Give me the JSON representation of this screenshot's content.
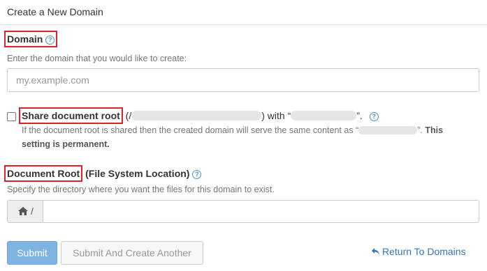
{
  "header": {
    "title": "Create a New Domain"
  },
  "domain": {
    "label": "Domain",
    "hint": "Enter the domain that you would like to create:",
    "placeholder": "my.example.com",
    "value": ""
  },
  "share_root": {
    "label": "Share document root",
    "open_paren": " (/",
    "with_text": ") with “",
    "close_text": "”.",
    "hint": "If the document root is shared then the created domain will serve the same content as “",
    "hint_end": "”.",
    "hint_bold": "This",
    "hint_bold2": "setting is permanent.",
    "checked": false
  },
  "document_root": {
    "label": "Document Root",
    "label_suffix": " (File System Location)",
    "hint": "Specify the directory where you want the files for this domain to exist.",
    "prefix": "/",
    "value": ""
  },
  "actions": {
    "submit_label": "Submit",
    "submit_another_label": "Submit And Create Another",
    "return_label": "Return To Domains"
  },
  "colors": {
    "accent": "#3576b8",
    "highlight_box": "#d9232d",
    "primary_button": "#7fb3e0"
  },
  "icons": {
    "help": "question-circle-icon",
    "home": "home-icon",
    "return": "return-arrow-icon"
  }
}
